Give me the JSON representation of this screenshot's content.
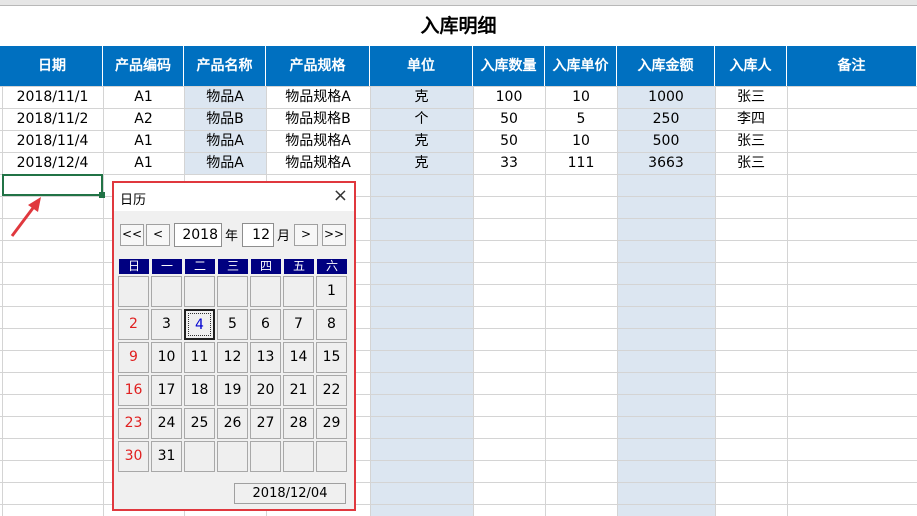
{
  "sheet": {
    "title": "入库明细",
    "headers": [
      "日期",
      "产品编码",
      "产品名称",
      "产品规格",
      "单位",
      "入库数量",
      "入库单价",
      "入库金额",
      "入库人",
      "备注"
    ],
    "rows": [
      [
        "2018/11/1",
        "A1",
        "物品A",
        "物品规格A",
        "克",
        "100",
        "10",
        "1000",
        "张三",
        ""
      ],
      [
        "2018/11/2",
        "A2",
        "物品B",
        "物品规格B",
        "个",
        "50",
        "5",
        "250",
        "李四",
        ""
      ],
      [
        "2018/11/4",
        "A1",
        "物品A",
        "物品规格A",
        "克",
        "50",
        "10",
        "500",
        "张三",
        ""
      ],
      [
        "2018/12/4",
        "A1",
        "物品A",
        "物品规格A",
        "克",
        "33",
        "111",
        "3663",
        "张三",
        ""
      ]
    ],
    "colors": {
      "header_bg": "#0070c0",
      "shaded_col": "#dce6f1",
      "selection": "#217346",
      "annotation": "#e0383e"
    }
  },
  "calendar": {
    "title": "日历",
    "close_icon": "×",
    "nav": {
      "prev_year": "<<",
      "prev_month": "<",
      "next_month": ">",
      "next_year": ">>"
    },
    "year": "2018",
    "year_label": "年",
    "month": "12",
    "month_label": "月",
    "weekdays": [
      "日",
      "一",
      "二",
      "三",
      "四",
      "五",
      "六"
    ],
    "days": [
      "1",
      "2",
      "3",
      "4",
      "5",
      "6",
      "7",
      "8",
      "9",
      "10",
      "11",
      "12",
      "13",
      "14",
      "15",
      "16",
      "17",
      "18",
      "19",
      "20",
      "21",
      "22",
      "23",
      "24",
      "25",
      "26",
      "27",
      "28",
      "29",
      "30",
      "31"
    ],
    "first_weekday": 6,
    "selected_day": "4",
    "selected_date": "2018/12/04"
  }
}
